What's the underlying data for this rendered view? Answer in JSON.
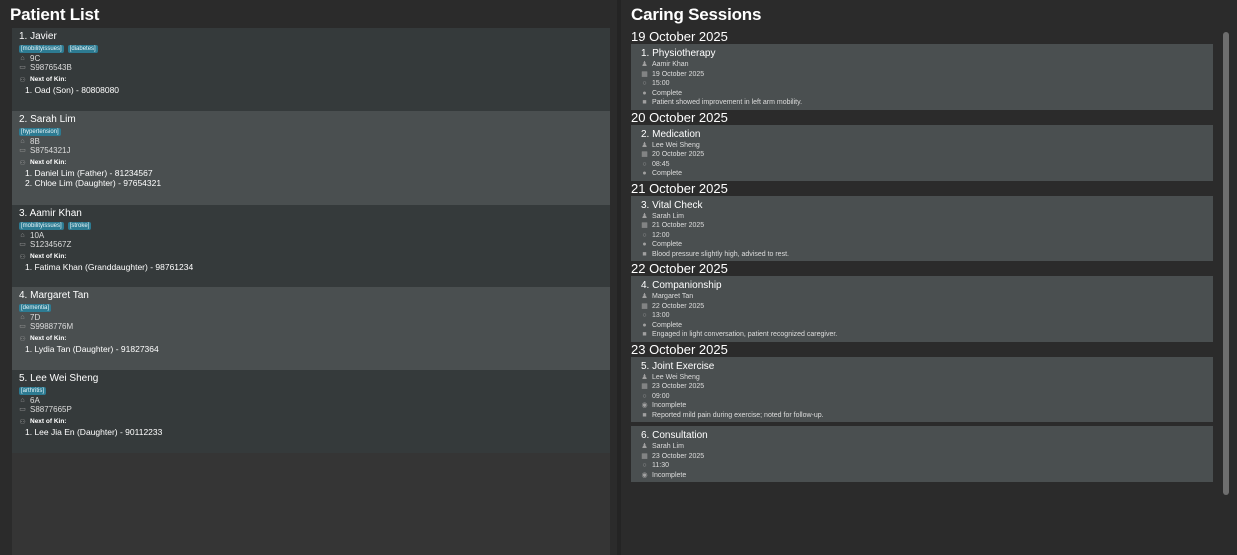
{
  "patient_list": {
    "title": "Patient List",
    "patients": [
      {
        "name": "1. Javier",
        "tags": [
          "[mobilityissues]",
          "[diabetes]"
        ],
        "room": "9C",
        "nric": "S9876543B",
        "nok_label": "Next of Kin:",
        "nok": [
          "1. Oad (Son) - 80808080"
        ]
      },
      {
        "name": "2. Sarah Lim",
        "tags": [
          "[hypertension]"
        ],
        "room": "8B",
        "nric": "S8754321J",
        "nok_label": "Next of Kin:",
        "nok": [
          "1. Daniel Lim (Father) - 81234567",
          "2. Chloe Lim (Daughter) - 97654321"
        ]
      },
      {
        "name": "3. Aamir Khan",
        "tags": [
          "[mobilityissues]",
          "[stroke]"
        ],
        "room": "10A",
        "nric": "S1234567Z",
        "nok_label": "Next of Kin:",
        "nok": [
          "1. Fatima Khan (Granddaughter) - 98761234"
        ]
      },
      {
        "name": "4. Margaret Tan",
        "tags": [
          "[dementia]"
        ],
        "room": "7D",
        "nric": "S9988776M",
        "nok_label": "Next of Kin:",
        "nok": [
          "1. Lydia Tan (Daughter) - 91827364"
        ]
      },
      {
        "name": "5. Lee Wei Sheng",
        "tags": [
          "[arthritis]"
        ],
        "room": "6A",
        "nric": "S8877665P",
        "nok_label": "Next of Kin:",
        "nok": [
          "1. Lee Jia En (Daughter) - 90112233"
        ]
      }
    ]
  },
  "caring_sessions": {
    "title": "Caring Sessions",
    "groups": [
      {
        "date": "19 October 2025",
        "sessions": [
          {
            "title": "1. Physiotherapy",
            "caregiver": "Aamir Khan",
            "date": "19 October 2025",
            "time": "15:00",
            "status": "Complete",
            "note": "Patient showed improvement in left arm mobility."
          }
        ]
      },
      {
        "date": "20 October 2025",
        "sessions": [
          {
            "title": "2. Medication",
            "caregiver": "Lee Wei Sheng",
            "date": "20 October 2025",
            "time": "08:45",
            "status": "Complete",
            "note": ""
          }
        ]
      },
      {
        "date": "21 October 2025",
        "sessions": [
          {
            "title": "3. Vital Check",
            "caregiver": "Sarah Lim",
            "date": "21 October 2025",
            "time": "12:00",
            "status": "Complete",
            "note": "Blood pressure slightly high, advised to rest."
          }
        ]
      },
      {
        "date": "22 October 2025",
        "sessions": [
          {
            "title": "4. Companionship",
            "caregiver": "Margaret Tan",
            "date": "22 October 2025",
            "time": "13:00",
            "status": "Complete",
            "note": "Engaged in light conversation, patient recognized caregiver."
          }
        ]
      },
      {
        "date": "23 October 2025",
        "sessions": [
          {
            "title": "5. Joint Exercise",
            "caregiver": "Lee Wei Sheng",
            "date": "23 October 2025",
            "time": "09:00",
            "status": "Incomplete",
            "note": "Reported mild pain during exercise; noted for follow-up."
          },
          {
            "title": "6. Consultation",
            "caregiver": "Sarah Lim",
            "date": "23 October 2025",
            "time": "11:30",
            "status": "Incomplete",
            "note": ""
          }
        ]
      }
    ]
  },
  "icons": {
    "room": "building-icon",
    "nric": "id-card-icon",
    "nok": "people-icon",
    "caregiver": "person-icon",
    "date": "calendar-icon",
    "time": "clock-icon",
    "status": "status-icon",
    "note": "note-icon"
  },
  "colors": {
    "tag_background": "#2d7b92",
    "card_light": "#4a4f50",
    "card_dark": "#353a3b",
    "background": "#2b2b2b"
  }
}
